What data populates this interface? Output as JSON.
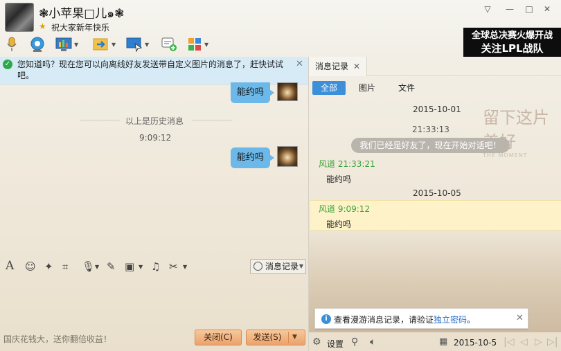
{
  "header": {
    "contact_name": "❃小苹果□儿๑❃",
    "signature": "祝大家新年快乐",
    "banner_line1": "全球总决赛火爆开战",
    "banner_line2": "关注LPL战队"
  },
  "tip": {
    "text": "您知道吗？现在您可以向离线好友发送带自定义图片的消息了，赶快试试吧。"
  },
  "chat": {
    "messages": [
      {
        "text": "能约吗"
      },
      {
        "text": "能约吗"
      }
    ],
    "history_divider": "以上是历史消息",
    "time": "9:09:12"
  },
  "input_toolbar": {
    "history_button": "消息记录"
  },
  "footer": {
    "ad_text": "国庆花钱大，送你翻倍收益！",
    "close_label": "关闭(C)",
    "send_label": "发送(S)"
  },
  "history_panel": {
    "tab_label": "消息记录",
    "filters": [
      "全部",
      "图片",
      "文件"
    ],
    "watermark_cn": "留下这片美好",
    "watermark_en": "THE MOMENT",
    "entries": {
      "date1": "2015-10-01",
      "sys_time": "21:33:13",
      "sys_msg": "我们已经是好友了，现在开始对话吧！",
      "sender1": "风道 21:33:21",
      "msg1": "能约吗",
      "date2": "2015-10-05",
      "sender2": "风道 9:09:12",
      "msg2": "能约吗"
    },
    "notice_text": "查看漫游消息记录，请验证",
    "notice_link": "独立密码",
    "notice_end": "。",
    "settings_label": "设置",
    "current_date": "2015-10-5"
  },
  "colors": {
    "accent_blue": "#3c8fd8",
    "bubble": "#6cb8e8",
    "sender_green": "#3aa33a",
    "button_orange": "#eba26c"
  }
}
